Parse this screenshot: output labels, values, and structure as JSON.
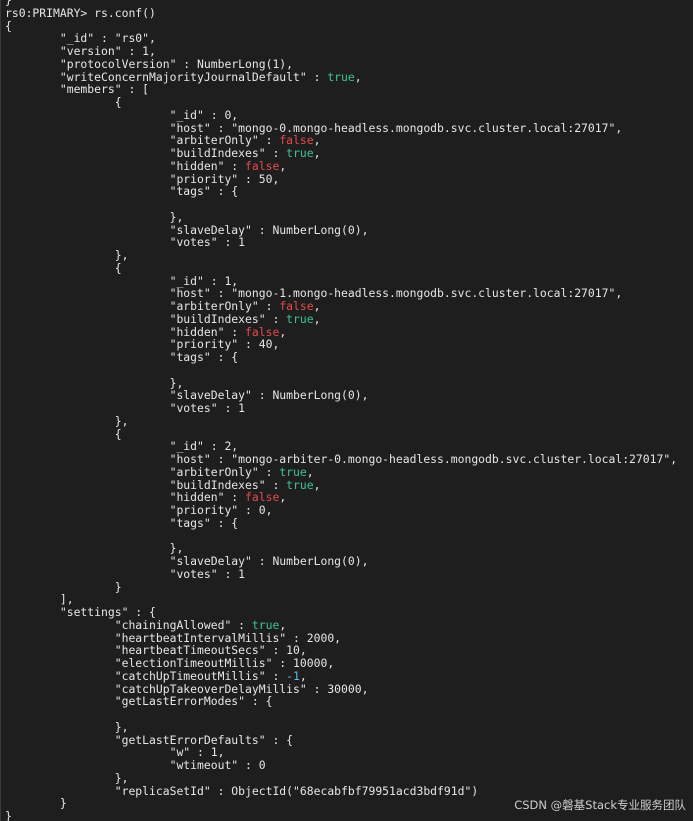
{
  "terminal": {
    "lines": [
      [
        {
          "t": "}",
          "c": "default"
        }
      ],
      [
        {
          "t": "rs0:PRIMARY> rs.conf()",
          "c": "default"
        }
      ],
      [
        {
          "t": "{",
          "c": "default"
        }
      ],
      [
        {
          "t": "        \"_id\" : \"rs0\",",
          "c": "default"
        }
      ],
      [
        {
          "t": "        \"version\" : 1,",
          "c": "default"
        }
      ],
      [
        {
          "t": "        \"protocolVersion\" : NumberLong(1),",
          "c": "default"
        }
      ],
      [
        {
          "t": "        \"writeConcernMajorityJournalDefault\" : ",
          "c": "default"
        },
        {
          "t": "true",
          "c": "true"
        },
        {
          "t": ",",
          "c": "default"
        }
      ],
      [
        {
          "t": "        \"members\" : [",
          "c": "default"
        }
      ],
      [
        {
          "t": "                {",
          "c": "default"
        }
      ],
      [
        {
          "t": "                        \"_id\" : 0,",
          "c": "default"
        }
      ],
      [
        {
          "t": "                        \"host\" : \"mongo-0.mongo-headless.mongodb.svc.cluster.local:27017\",",
          "c": "default"
        }
      ],
      [
        {
          "t": "                        \"arbiterOnly\" : ",
          "c": "default"
        },
        {
          "t": "false",
          "c": "false"
        },
        {
          "t": ",",
          "c": "default"
        }
      ],
      [
        {
          "t": "                        \"buildIndexes\" : ",
          "c": "default"
        },
        {
          "t": "true",
          "c": "true"
        },
        {
          "t": ",",
          "c": "default"
        }
      ],
      [
        {
          "t": "                        \"hidden\" : ",
          "c": "default"
        },
        {
          "t": "false",
          "c": "false"
        },
        {
          "t": ",",
          "c": "default"
        }
      ],
      [
        {
          "t": "                        \"priority\" : 50,",
          "c": "default"
        }
      ],
      [
        {
          "t": "                        \"tags\" : {",
          "c": "default"
        }
      ],
      [
        {
          "t": "",
          "c": "default"
        }
      ],
      [
        {
          "t": "                        },",
          "c": "default"
        }
      ],
      [
        {
          "t": "                        \"slaveDelay\" : NumberLong(0),",
          "c": "default"
        }
      ],
      [
        {
          "t": "                        \"votes\" : 1",
          "c": "default"
        }
      ],
      [
        {
          "t": "                },",
          "c": "default"
        }
      ],
      [
        {
          "t": "                {",
          "c": "default"
        }
      ],
      [
        {
          "t": "                        \"_id\" : 1,",
          "c": "default"
        }
      ],
      [
        {
          "t": "                        \"host\" : \"mongo-1.mongo-headless.mongodb.svc.cluster.local:27017\",",
          "c": "default"
        }
      ],
      [
        {
          "t": "                        \"arbiterOnly\" : ",
          "c": "default"
        },
        {
          "t": "false",
          "c": "false"
        },
        {
          "t": ",",
          "c": "default"
        }
      ],
      [
        {
          "t": "                        \"buildIndexes\" : ",
          "c": "default"
        },
        {
          "t": "true",
          "c": "true"
        },
        {
          "t": ",",
          "c": "default"
        }
      ],
      [
        {
          "t": "                        \"hidden\" : ",
          "c": "default"
        },
        {
          "t": "false",
          "c": "false"
        },
        {
          "t": ",",
          "c": "default"
        }
      ],
      [
        {
          "t": "                        \"priority\" : 40,",
          "c": "default"
        }
      ],
      [
        {
          "t": "                        \"tags\" : {",
          "c": "default"
        }
      ],
      [
        {
          "t": "",
          "c": "default"
        }
      ],
      [
        {
          "t": "                        },",
          "c": "default"
        }
      ],
      [
        {
          "t": "                        \"slaveDelay\" : NumberLong(0),",
          "c": "default"
        }
      ],
      [
        {
          "t": "                        \"votes\" : 1",
          "c": "default"
        }
      ],
      [
        {
          "t": "                },",
          "c": "default"
        }
      ],
      [
        {
          "t": "                {",
          "c": "default"
        }
      ],
      [
        {
          "t": "                        \"_id\" : 2,",
          "c": "default"
        }
      ],
      [
        {
          "t": "                        \"host\" : \"mongo-arbiter-0.mongo-headless.mongodb.svc.cluster.local:27017\",",
          "c": "default"
        }
      ],
      [
        {
          "t": "                        \"arbiterOnly\" : ",
          "c": "default"
        },
        {
          "t": "true",
          "c": "true"
        },
        {
          "t": ",",
          "c": "default"
        }
      ],
      [
        {
          "t": "                        \"buildIndexes\" : ",
          "c": "default"
        },
        {
          "t": "true",
          "c": "true"
        },
        {
          "t": ",",
          "c": "default"
        }
      ],
      [
        {
          "t": "                        \"hidden\" : ",
          "c": "default"
        },
        {
          "t": "false",
          "c": "false"
        },
        {
          "t": ",",
          "c": "default"
        }
      ],
      [
        {
          "t": "                        \"priority\" : 0,",
          "c": "default"
        }
      ],
      [
        {
          "t": "                        \"tags\" : {",
          "c": "default"
        }
      ],
      [
        {
          "t": "",
          "c": "default"
        }
      ],
      [
        {
          "t": "                        },",
          "c": "default"
        }
      ],
      [
        {
          "t": "                        \"slaveDelay\" : NumberLong(0),",
          "c": "default"
        }
      ],
      [
        {
          "t": "                        \"votes\" : 1",
          "c": "default"
        }
      ],
      [
        {
          "t": "                }",
          "c": "default"
        }
      ],
      [
        {
          "t": "        ],",
          "c": "default"
        }
      ],
      [
        {
          "t": "        \"settings\" : {",
          "c": "default"
        }
      ],
      [
        {
          "t": "                \"chainingAllowed\" : ",
          "c": "default"
        },
        {
          "t": "true",
          "c": "true"
        },
        {
          "t": ",",
          "c": "default"
        }
      ],
      [
        {
          "t": "                \"heartbeatIntervalMillis\" : 2000,",
          "c": "default"
        }
      ],
      [
        {
          "t": "                \"heartbeatTimeoutSecs\" : 10,",
          "c": "default"
        }
      ],
      [
        {
          "t": "                \"electionTimeoutMillis\" : 10000,",
          "c": "default"
        }
      ],
      [
        {
          "t": "                \"catchUpTimeoutMillis\" : ",
          "c": "default"
        },
        {
          "t": "-1",
          "c": "num"
        },
        {
          "t": ",",
          "c": "default"
        }
      ],
      [
        {
          "t": "                \"catchUpTakeoverDelayMillis\" : 30000,",
          "c": "default"
        }
      ],
      [
        {
          "t": "                \"getLastErrorModes\" : {",
          "c": "default"
        }
      ],
      [
        {
          "t": "",
          "c": "default"
        }
      ],
      [
        {
          "t": "                },",
          "c": "default"
        }
      ],
      [
        {
          "t": "                \"getLastErrorDefaults\" : {",
          "c": "default"
        }
      ],
      [
        {
          "t": "                        \"w\" : 1,",
          "c": "default"
        }
      ],
      [
        {
          "t": "                        \"wtimeout\" : 0",
          "c": "default"
        }
      ],
      [
        {
          "t": "                },",
          "c": "default"
        }
      ],
      [
        {
          "t": "                \"replicaSetId\" : ObjectId(\"68ecabfbf79951acd3bdf91d\")",
          "c": "default"
        }
      ],
      [
        {
          "t": "        }",
          "c": "default"
        }
      ],
      [
        {
          "t": "}",
          "c": "default"
        }
      ]
    ]
  },
  "watermark": {
    "text": "CSDN @磐基Stack专业服务团队"
  },
  "colors": {
    "background": "#1e1e1e",
    "text": "#e6e6e6",
    "true": "#3cc48f",
    "false": "#e24b4b",
    "number": "#5bb8e8"
  }
}
